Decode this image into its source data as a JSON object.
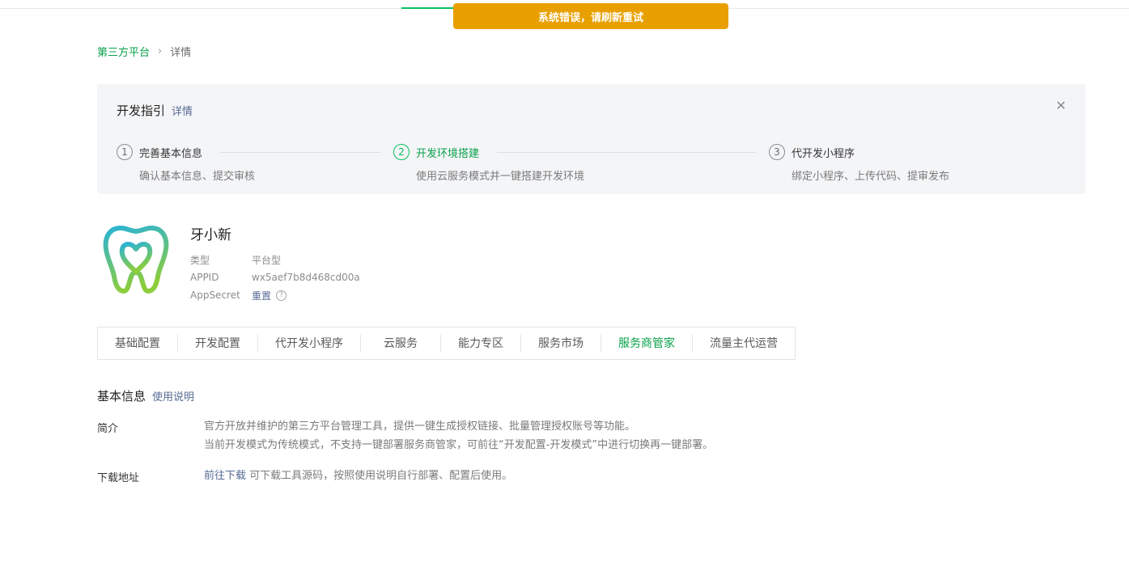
{
  "toast": {
    "message": "系统错误，请刷新重试"
  },
  "breadcrumb": {
    "parent": "第三方平台",
    "current": "详情"
  },
  "guide": {
    "title": "开发指引",
    "detail_link": "详情",
    "close_icon": "close-icon",
    "steps": [
      {
        "num": "1",
        "label": "完善基本信息",
        "desc": "确认基本信息、提交审核",
        "active": false
      },
      {
        "num": "2",
        "label": "开发环境搭建",
        "desc": "使用云服务模式并一键搭建开发环境",
        "active": true
      },
      {
        "num": "3",
        "label": "代开发小程序",
        "desc": "绑定小程序、上传代码、提审发布",
        "active": false
      }
    ]
  },
  "app": {
    "name": "牙小新",
    "type_label": "类型",
    "type_value": "平台型",
    "appid_label": "APPID",
    "appid_value": "wx5aef7b8d468cd00a",
    "secret_label": "AppSecret",
    "secret_action": "重置",
    "help_icon": "?"
  },
  "tabs": [
    {
      "label": "基础配置",
      "active": false
    },
    {
      "label": "开发配置",
      "active": false
    },
    {
      "label": "代开发小程序",
      "active": false
    },
    {
      "label": "云服务",
      "active": false
    },
    {
      "label": "能力专区",
      "active": false
    },
    {
      "label": "服务市场",
      "active": false
    },
    {
      "label": "服务商管家",
      "active": true
    },
    {
      "label": "流量主代运营",
      "active": false
    }
  ],
  "basic_info": {
    "title": "基本信息",
    "usage_link": "使用说明",
    "intro_label": "简介",
    "intro_line1": "官方开放并维护的第三方平台管理工具，提供一键生成授权链接、批量管理授权账号等功能。",
    "intro_line2": "当前开发模式为传统模式，不支持一键部署服务商管家，可前往“开发配置-开发模式”中进行切换再一键部署。",
    "download_label": "下载地址",
    "download_link": "前往下载",
    "download_text": "可下载工具源码，按照使用说明自行部署、配置后使用。"
  },
  "colors": {
    "accent": "#07c160",
    "toast": "#e8a000",
    "link": "#576b95"
  }
}
